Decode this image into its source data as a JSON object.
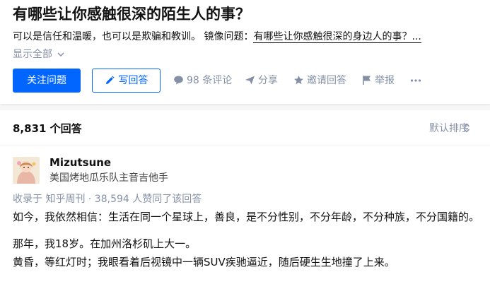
{
  "question": {
    "title": "有哪些让你感触很深的陌生人的事？",
    "detail_text": "可以是信任和温暖，也可以是欺骗和教训。 镜像问题：",
    "detail_link": "有哪些让你感触很深的身边人的事？...",
    "show_all": "显示全部",
    "follow_label": "关注问题",
    "write_answer_label": "写回答",
    "actions": {
      "comments": "98 条评论",
      "share": "分享",
      "invite": "邀请回答",
      "report": "举报"
    }
  },
  "answers": {
    "count_label": "8,831 个回答",
    "sort_label": "默认排序"
  },
  "answer": {
    "author_name": "Mizutsune",
    "author_bio": "美国烤地瓜乐队主音吉他手",
    "meta": "收录于 知乎周刊 · 38,594 人赞同了该回答",
    "paragraphs": [
      "如今，我依然相信：生活在同一个星球上，善良，是不分性别，不分年龄，不分种族，不分国籍的。",
      "那年，我18岁。在加州洛杉矶上大一。\n黄昏，等红灯时；我眼看着后视镜中一辆SUV疾驰逼近，随后硬生生地撞了上来。"
    ]
  },
  "colors": {
    "accent": "#0066ff",
    "muted": "#8590a6"
  }
}
